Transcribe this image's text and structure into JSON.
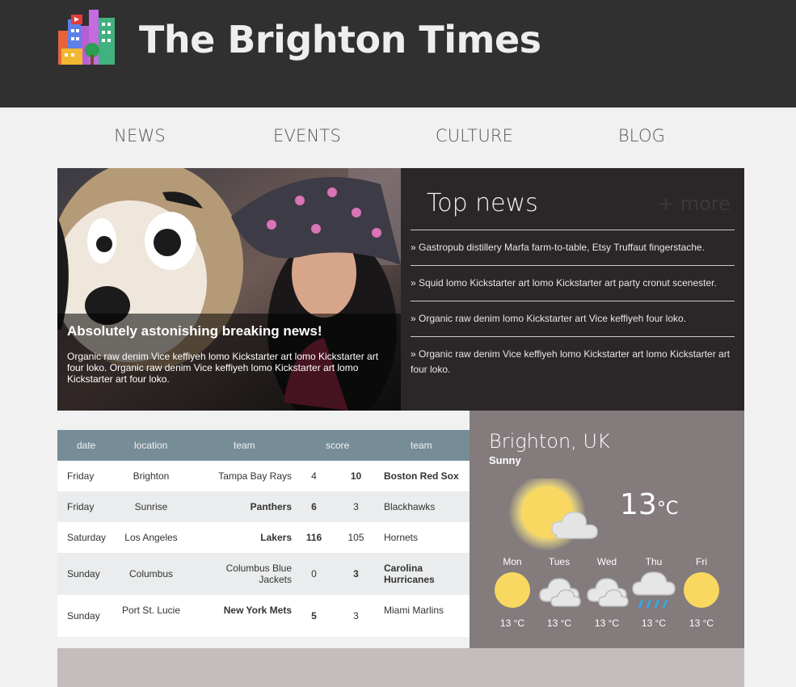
{
  "header": {
    "site_title": "The Brighton Times",
    "logo_icon": "city-buildings-icon"
  },
  "nav": {
    "items": [
      "NEWS",
      "EVENTS",
      "CULTURE",
      "BLOG"
    ]
  },
  "hero": {
    "headline": "Absolutely astonishing breaking news!",
    "text": "Organic raw denim Vice keffiyeh lomo Kickstarter art lomo Kickstarter art four loko. Organic raw denim Vice keffiyeh lomo Kickstarter art lomo Kickstarter art four loko."
  },
  "topnews": {
    "title": "Top news",
    "more": "+ more",
    "items": [
      "» Gastropub distillery Marfa farm-to-table, Etsy Truffaut fingerstache.",
      "» Squid lomo Kickstarter art lomo Kickstarter art party cronut scenester.",
      "» Organic raw denim lomo Kickstarter art Vice keffiyeh four loko.",
      "» Organic raw denim Vice keffiyeh lomo Kickstarter art lomo Kickstarter art four loko."
    ]
  },
  "scores": {
    "headers": [
      "date",
      "location",
      "team",
      "score",
      "team"
    ],
    "rows": [
      {
        "date": "Friday",
        "location": "Brighton",
        "home": "Tampa Bay Rays",
        "home_score": "4",
        "away_score": "10",
        "away": "Boston Red Sox",
        "winner": "away"
      },
      {
        "date": "Friday",
        "location": "Sunrise",
        "home": "Panthers",
        "home_score": "6",
        "away_score": "3",
        "away": "Blackhawks",
        "winner": "home"
      },
      {
        "date": "Saturday",
        "location": "Los Angeles",
        "home": "Lakers",
        "home_score": "116",
        "away_score": "105",
        "away": "Hornets",
        "winner": "home"
      },
      {
        "date": "Sunday",
        "location": "Columbus",
        "home": "Columbus Blue Jackets",
        "home_score": "0",
        "away_score": "3",
        "away": "Carolina Hurricanes",
        "winner": "away"
      },
      {
        "date": "Sunday",
        "location": "Port St. Lucie",
        "home": "New York Mets",
        "home_score": "5",
        "away_score": "3",
        "away": "Miami Marlins",
        "winner": "home"
      }
    ]
  },
  "weather": {
    "city": "Brighton, UK",
    "condition": "Sunny",
    "temp": "13",
    "unit": "°C",
    "icon": "sun-behind-cloud-icon",
    "forecast": [
      {
        "day": "Mon",
        "temp": "13 °C",
        "icon": "sun-icon"
      },
      {
        "day": "Tues",
        "temp": "13 °C",
        "icon": "cloudy-icon"
      },
      {
        "day": "Wed",
        "temp": "13 °C",
        "icon": "cloudy-icon"
      },
      {
        "day": "Thu",
        "temp": "13 °C",
        "icon": "rain-icon"
      },
      {
        "day": "Fri",
        "temp": "13 °C",
        "icon": "sun-icon"
      }
    ]
  },
  "colors": {
    "header_bg": "#303030",
    "topnews_bg": "#2b2728",
    "table_head": "#768c97",
    "weather_bg": "#837b7c",
    "sun": "#f8d860"
  }
}
